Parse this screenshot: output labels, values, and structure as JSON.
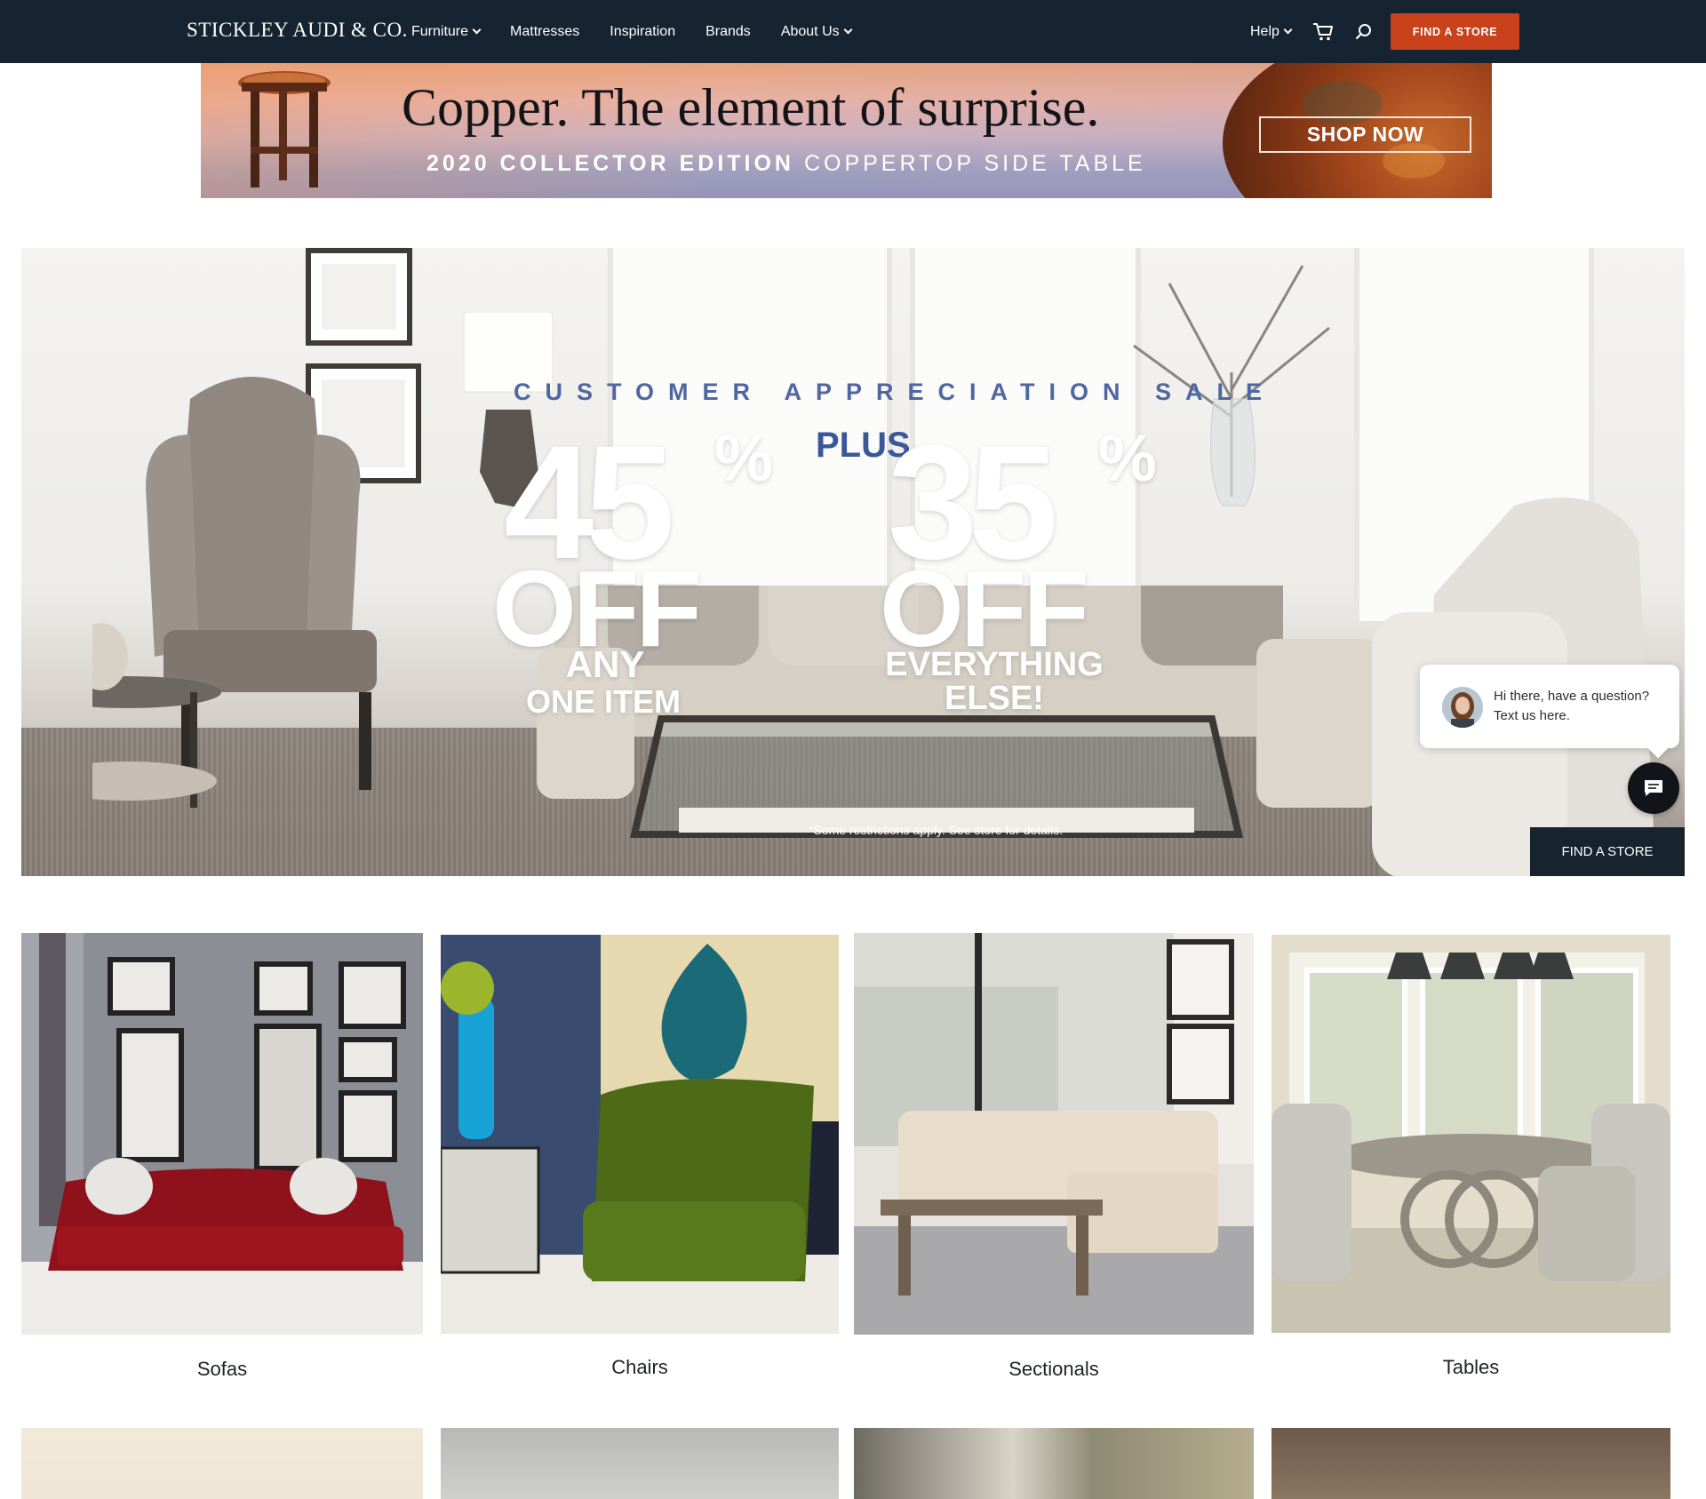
{
  "nav": {
    "logo": "STICKLEY AUDI & CO.",
    "links": [
      {
        "label": "Furniture",
        "dropdown": true
      },
      {
        "label": "Mattresses",
        "dropdown": false
      },
      {
        "label": "Inspiration",
        "dropdown": false
      },
      {
        "label": "Brands",
        "dropdown": false
      },
      {
        "label": "About Us",
        "dropdown": true
      }
    ],
    "help_label": "Help",
    "cart_icon": "cart-icon",
    "search_icon": "search-icon",
    "find_store_label": "FIND A STORE",
    "colors": {
      "bar": "#162330",
      "accent": "#c9421b"
    }
  },
  "promo": {
    "headline": "Copper. The element of surprise.",
    "sub_bold": "2020 COLLECTOR EDITION",
    "sub_rest": " COPPERTOP SIDE TABLE",
    "cta": "SHOP NOW"
  },
  "hero": {
    "sale_title": "CUSTOMER APPRECIATION SALE",
    "plus": "PLUS",
    "offer1": {
      "percent": "45",
      "symbol": "%",
      "off": "OFF",
      "line1": "ANY",
      "line2": "ONE ITEM"
    },
    "offer2": {
      "percent": "35",
      "symbol": "%",
      "off": "OFF",
      "line1": "EVERYTHING",
      "line2": "ELSE!"
    },
    "disclaimer": "*Some restrictions apply. See store for details.",
    "find_store_label": "FIND A STORE",
    "colors": {
      "title": "#5066a0",
      "plus": "#3a5797"
    }
  },
  "chat": {
    "message": "Hi there, have a question? Text us here.",
    "button_icon": "chat-icon"
  },
  "categories": [
    {
      "label": "Sofas"
    },
    {
      "label": "Chairs"
    },
    {
      "label": "Sectionals"
    },
    {
      "label": "Tables"
    }
  ]
}
